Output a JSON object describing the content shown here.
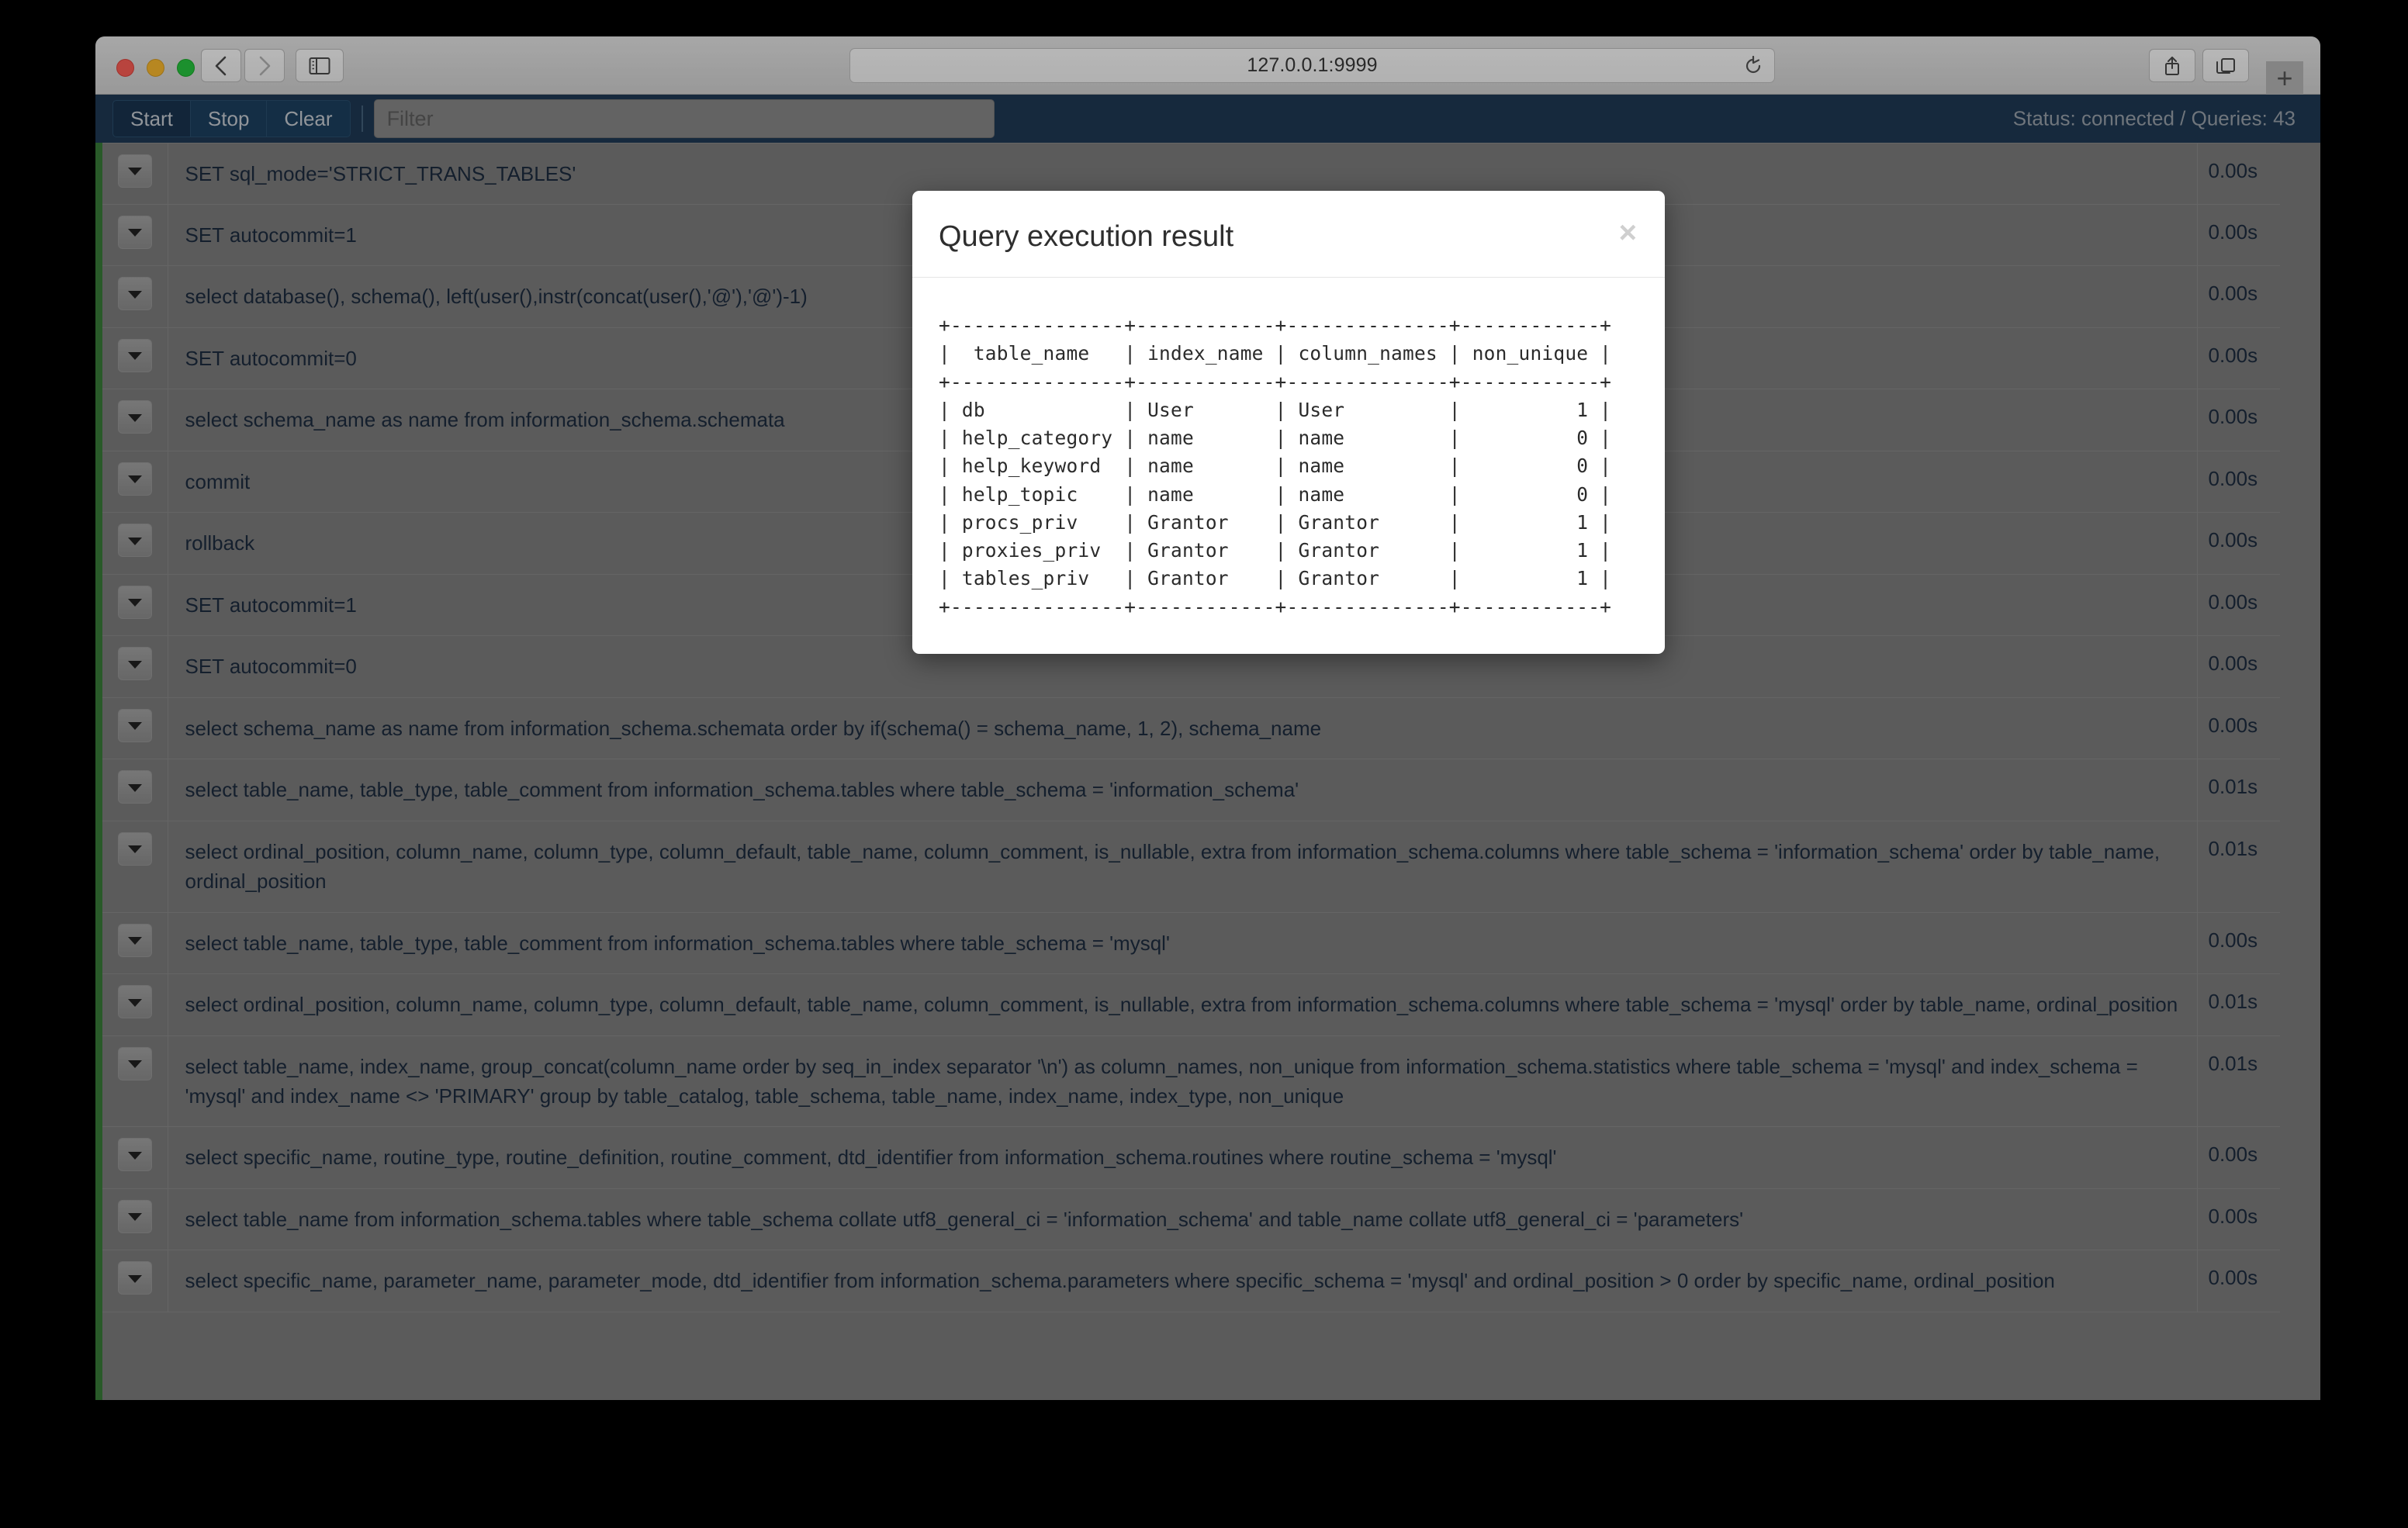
{
  "browser": {
    "url": "127.0.0.1:9999",
    "back_icon": "chevron-left-icon",
    "forward_icon": "chevron-right-icon",
    "sidebar_icon": "sidebar-toggle-icon",
    "reload_icon": "reload-icon",
    "share_icon": "share-icon",
    "tabs_icon": "show-tabs-icon",
    "new_tab_label": "+"
  },
  "toolbar": {
    "start_label": "Start",
    "stop_label": "Stop",
    "clear_label": "Clear",
    "filter_placeholder": "Filter",
    "filter_value": "",
    "status": "Status: connected / Queries: 43"
  },
  "colors": {
    "toolbar_bg": "#1f3a55",
    "list_bg": "#7e7e7e",
    "accent_green": "#3a7d3a",
    "sql_text": "#1d2b3f"
  },
  "query_list": {
    "rows": [
      {
        "sql": "SET sql_mode='STRICT_TRANS_TABLES'",
        "time": "0.00s"
      },
      {
        "sql": "SET autocommit=1",
        "time": "0.00s"
      },
      {
        "sql": "select database(), schema(), left(user(),instr(concat(user(),'@'),'@')-1)",
        "time": "0.00s"
      },
      {
        "sql": "SET autocommit=0",
        "time": "0.00s"
      },
      {
        "sql": "select schema_name as name from information_schema.schemata",
        "time": "0.00s"
      },
      {
        "sql": "commit",
        "time": "0.00s"
      },
      {
        "sql": "rollback",
        "time": "0.00s"
      },
      {
        "sql": "SET autocommit=1",
        "time": "0.00s"
      },
      {
        "sql": "SET autocommit=0",
        "time": "0.00s"
      },
      {
        "sql": "select schema_name as name from information_schema.schemata order by if(schema() = schema_name, 1, 2), schema_name",
        "time": "0.00s"
      },
      {
        "sql": "select table_name, table_type, table_comment from information_schema.tables where table_schema = 'information_schema'",
        "time": "0.01s"
      },
      {
        "sql": "select ordinal_position, column_name, column_type, column_default, table_name, column_comment, is_nullable, extra from information_schema.columns where table_schema = 'information_schema' order by table_name, ordinal_position",
        "time": "0.01s"
      },
      {
        "sql": "select table_name, table_type, table_comment from information_schema.tables where table_schema = 'mysql'",
        "time": "0.00s"
      },
      {
        "sql": "select ordinal_position, column_name, column_type, column_default, table_name, column_comment, is_nullable, extra from information_schema.columns where table_schema = 'mysql' order by table_name, ordinal_position",
        "time": "0.01s"
      },
      {
        "sql": "select table_name, index_name, group_concat(column_name order by seq_in_index separator '\\n') as column_names, non_unique from information_schema.statistics where table_schema = 'mysql' and index_schema = 'mysql' and index_name <> 'PRIMARY' group by table_catalog, table_schema, table_name, index_name, index_type, non_unique",
        "time": "0.01s"
      },
      {
        "sql": "select specific_name, routine_type, routine_definition, routine_comment, dtd_identifier from information_schema.routines where routine_schema = 'mysql'",
        "time": "0.00s"
      },
      {
        "sql": "select table_name from information_schema.tables where table_schema collate utf8_general_ci = 'information_schema' and table_name collate utf8_general_ci = 'parameters'",
        "time": "0.00s"
      },
      {
        "sql": "select specific_name, parameter_name, parameter_mode, dtd_identifier from information_schema.parameters where specific_schema = 'mysql' and ordinal_position > 0 order by specific_name, ordinal_position",
        "time": "0.00s"
      }
    ]
  },
  "modal": {
    "title": "Query execution result",
    "close_label": "×",
    "result_text": "+--------------+------------+--------------+------------+\n|  table_name  | index_name | column_names | non_unique |\n+--------------+------------+--------------+------------+\n| db           | User       | User         |          1 |\n| help_category | name      | name         |          0 |\n| help_keyword | name       | name         |          0 |\n| help_topic   | name       | name         |          0 |\n| procs_priv   | Grantor    | Grantor      |          1 |\n| proxies_priv | Grantor    | Grantor      |          1 |\n| tables_priv  | Grantor    | Grantor      |          1 |\n+--------------+------------+--------------+------------+",
    "result_table": {
      "headers": [
        "table_name",
        "index_name",
        "column_names",
        "non_unique"
      ],
      "rows": [
        [
          "db",
          "User",
          "User",
          "1"
        ],
        [
          "help_category",
          "name",
          "name",
          "0"
        ],
        [
          "help_keyword",
          "name",
          "name",
          "0"
        ],
        [
          "help_topic",
          "name",
          "name",
          "0"
        ],
        [
          "procs_priv",
          "Grantor",
          "Grantor",
          "1"
        ],
        [
          "proxies_priv",
          "Grantor",
          "Grantor",
          "1"
        ],
        [
          "tables_priv",
          "Grantor",
          "Grantor",
          "1"
        ]
      ]
    }
  }
}
